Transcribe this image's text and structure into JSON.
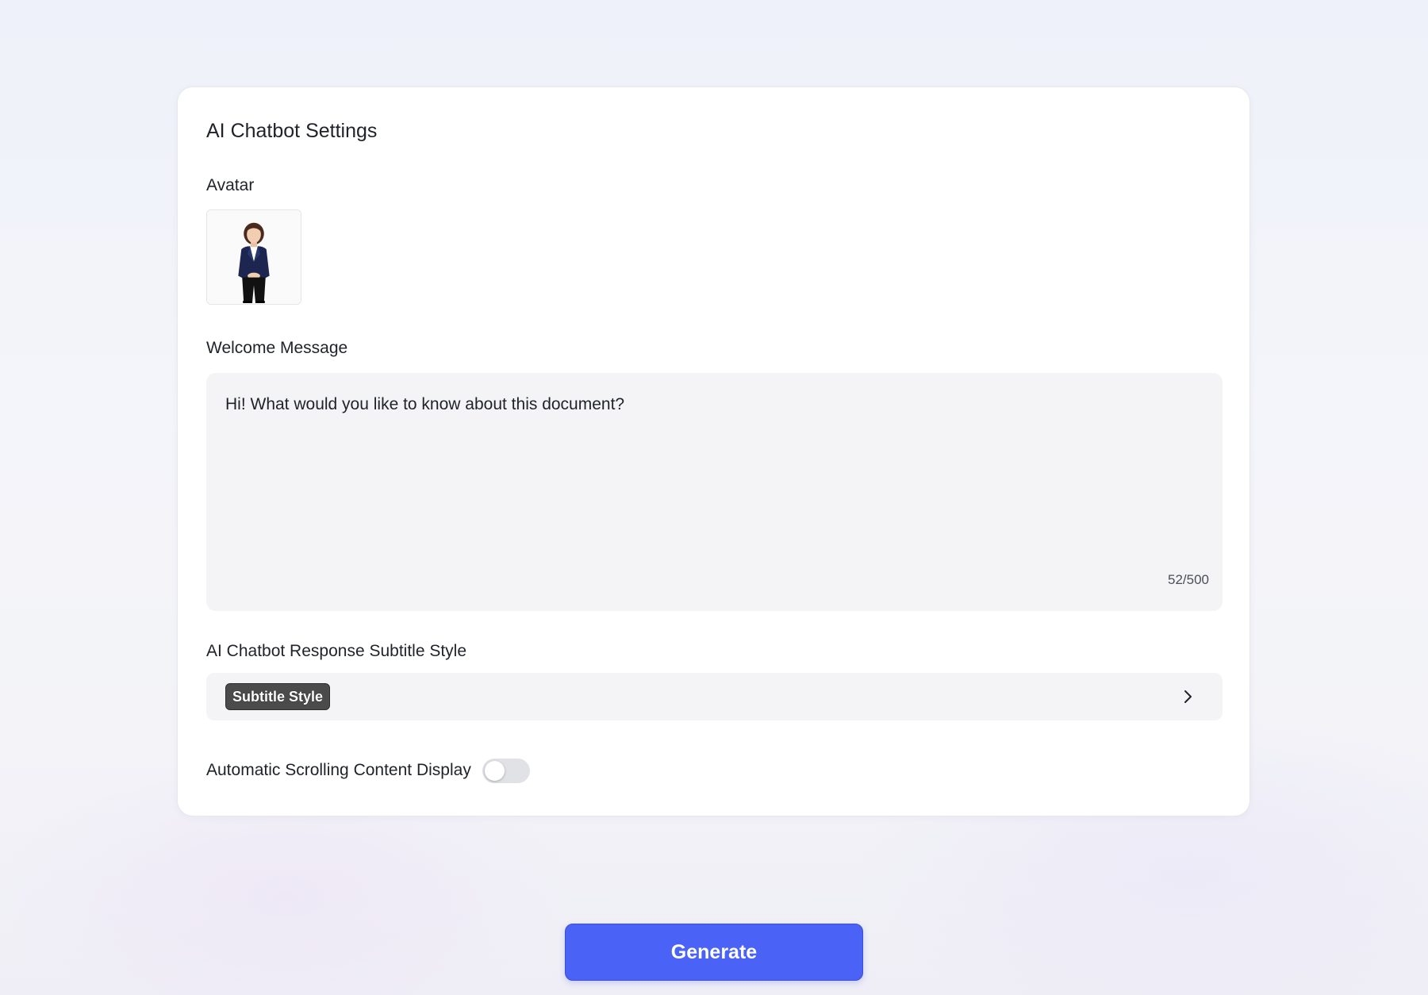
{
  "settings": {
    "title": "AI Chatbot Settings",
    "avatar_label": "Avatar",
    "avatar_icon": "woman-in-business-suit-avatar",
    "welcome": {
      "label": "Welcome Message",
      "value": "Hi! What would you like to know about this document?",
      "char_count": "52/500"
    },
    "subtitle": {
      "label": "AI Chatbot Response Subtitle Style",
      "selected": "Subtitle Style",
      "icon": "chevron-right-icon"
    },
    "auto_scroll": {
      "label": "Automatic Scrolling Content Display",
      "enabled": false
    }
  },
  "generate_label": "Generate",
  "colors": {
    "accent": "#4a62f5",
    "input_bg": "#f4f4f6",
    "chip_bg": "#4b4b4b",
    "toggle_off": "#e1e2e6"
  }
}
